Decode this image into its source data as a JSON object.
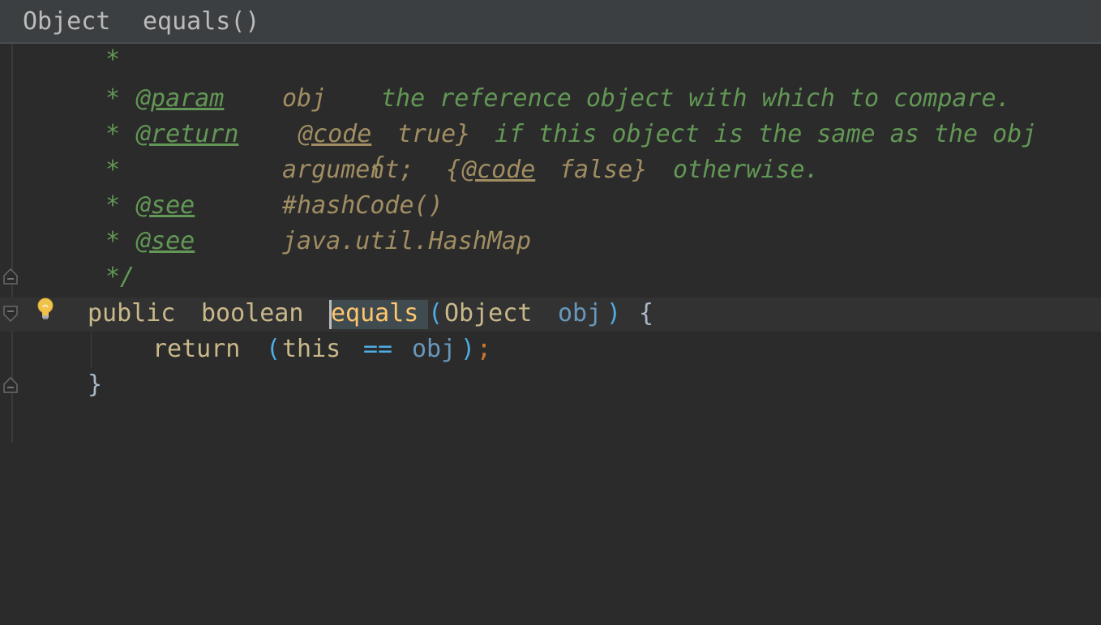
{
  "breadcrumb": {
    "items": [
      "Object",
      "equals()"
    ]
  },
  "code": {
    "doc_lines": [
      {
        "star": "*"
      },
      {
        "star": "*",
        "tag": "@param",
        "name": "obj",
        "text": "the reference object with which to compare."
      },
      {
        "star": "*",
        "tag": "@return",
        "code_tag_1": "{@code",
        "code_val_1": "true}",
        "text": "if this object is the same as the obj"
      },
      {
        "star": "*",
        "text_a": "argument;",
        "code_tag": "{@code",
        "code_val": "false}",
        "text_b": "otherwise."
      },
      {
        "star": "*",
        "tag": "@see",
        "ref": "#hashCode()"
      },
      {
        "star": "*",
        "tag": "@see",
        "ref": "java.util.HashMap"
      },
      {
        "star": "*/"
      }
    ],
    "signature": {
      "modifier": "public",
      "type": "boolean",
      "method": "equals",
      "open_paren": "(",
      "param_type": "Object",
      "param_name": "obj",
      "close_paren": ")",
      "brace": "{"
    },
    "body": {
      "keyword": "return",
      "open_paren": "(",
      "this": "this",
      "op": "==",
      "var": "obj",
      "close_paren": ")",
      "semi": ";"
    },
    "close_brace": "}"
  },
  "icons": {
    "intention": "lightbulb-icon",
    "fold": "fold-marker-icon"
  },
  "colors": {
    "background": "#2b2b2b",
    "doc_comment": "#629755",
    "keyword": "#cc7832",
    "method": "#ffc66d",
    "parameter": "#6897bb"
  }
}
